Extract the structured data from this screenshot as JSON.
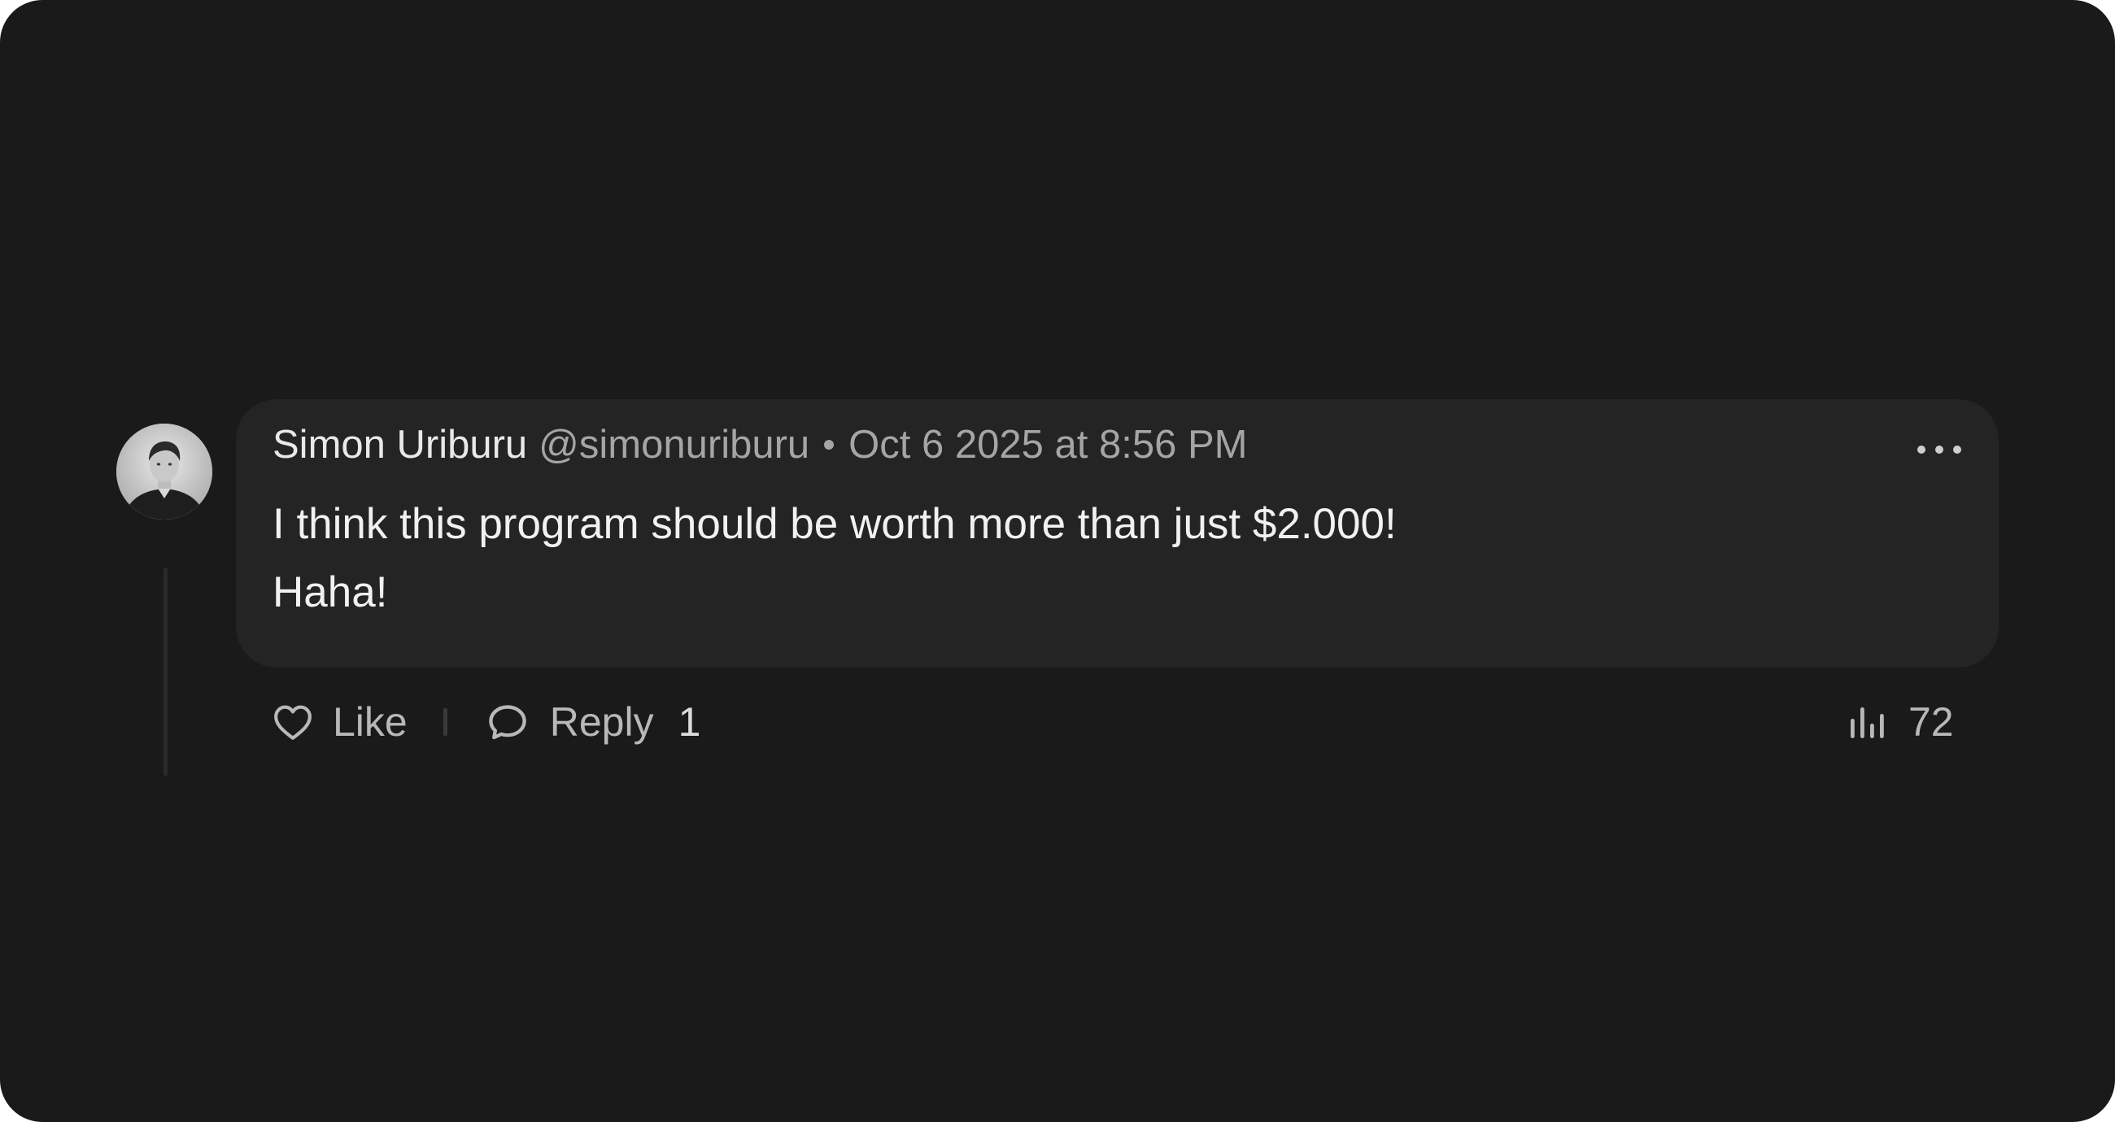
{
  "comment": {
    "author_name": "Simon Uriburu",
    "author_handle": "@simonuriburu",
    "timestamp": "Oct 6 2025 at 8:56 PM",
    "body_lines": [
      "I think this program should be worth more than just $2.000!",
      "Haha!"
    ],
    "avatar_icon": "user-photo",
    "more_icon": "more-horizontal-icon"
  },
  "actions": {
    "like_label": "Like",
    "like_icon": "heart-icon",
    "reply_label": "Reply",
    "reply_icon": "chat-bubble-icon",
    "reply_count": "1",
    "views_icon": "bar-chart-icon",
    "views_count": "72"
  },
  "colors": {
    "page_background": "#1a1a1a",
    "bubble_background": "#242424",
    "primary_text": "#f1f1f1",
    "secondary_text": "#a5a5a5"
  }
}
